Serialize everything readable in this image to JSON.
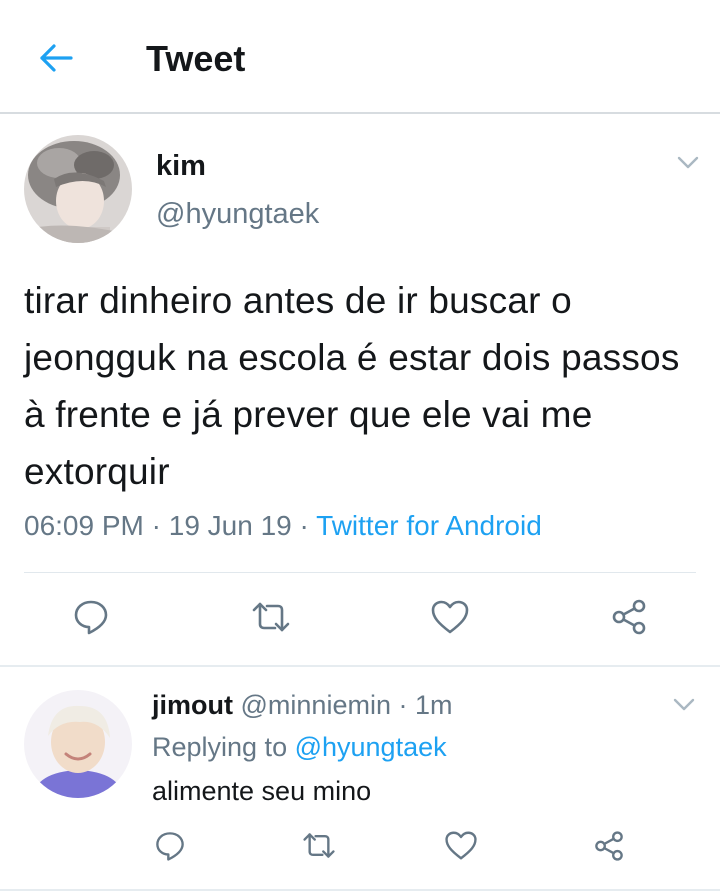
{
  "header": {
    "title": "Tweet",
    "back_icon": "arrow-left-icon"
  },
  "tweet": {
    "author_name": "kim",
    "author_handle": "@hyungtaek",
    "text": "tirar dinheiro antes de ir buscar o jeongguk na escola é estar dois passos à frente e já prever que ele vai me extorquir",
    "time": "06:09 PM",
    "date": "19 Jun 19",
    "separator": " · ",
    "source": "Twitter for Android",
    "actions": [
      "reply-icon",
      "retweet-icon",
      "like-icon",
      "share-icon"
    ]
  },
  "reply": {
    "author_name": "jimout",
    "author_handle": "@minniemin",
    "age": "1m",
    "dot": " · ",
    "replying_prefix": "Replying to ",
    "replying_to": "@hyungtaek",
    "text": "alimente seu mino",
    "actions": [
      "reply-icon",
      "retweet-icon",
      "like-icon",
      "share-icon"
    ]
  },
  "colors": {
    "accent": "#1da1f2",
    "secondary_text": "#657786",
    "divider": "#e1e8ed"
  }
}
